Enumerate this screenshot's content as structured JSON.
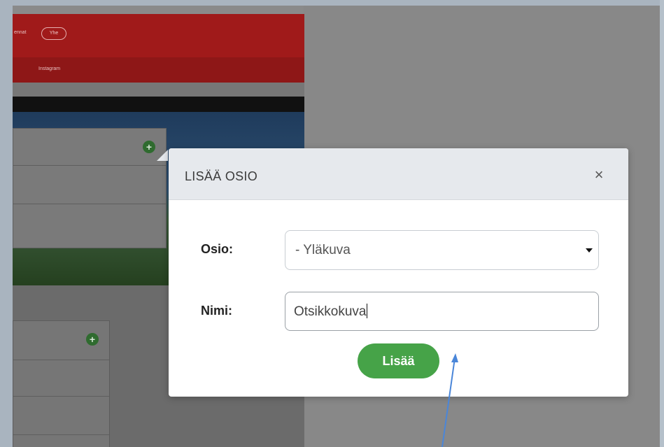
{
  "background_page": {
    "nav": {
      "partial_text": "ennat",
      "pill_label": "Yhe",
      "instagram_label": "Instagram"
    },
    "add_icon": "plus-circle-icon"
  },
  "modal": {
    "title": "LISÄÄ OSIO",
    "close_label": "×",
    "fields": {
      "section": {
        "label": "Osio:",
        "selected_value": "- Yläkuva"
      },
      "name": {
        "label": "Nimi:",
        "value": "Otsikkokuva"
      }
    },
    "add_button_label": "Lisää"
  },
  "colors": {
    "header_bg": "#e6e9ed",
    "add_button": "#46a348",
    "arrow": "#4a86d9",
    "nav_red": "#a01a1a"
  }
}
